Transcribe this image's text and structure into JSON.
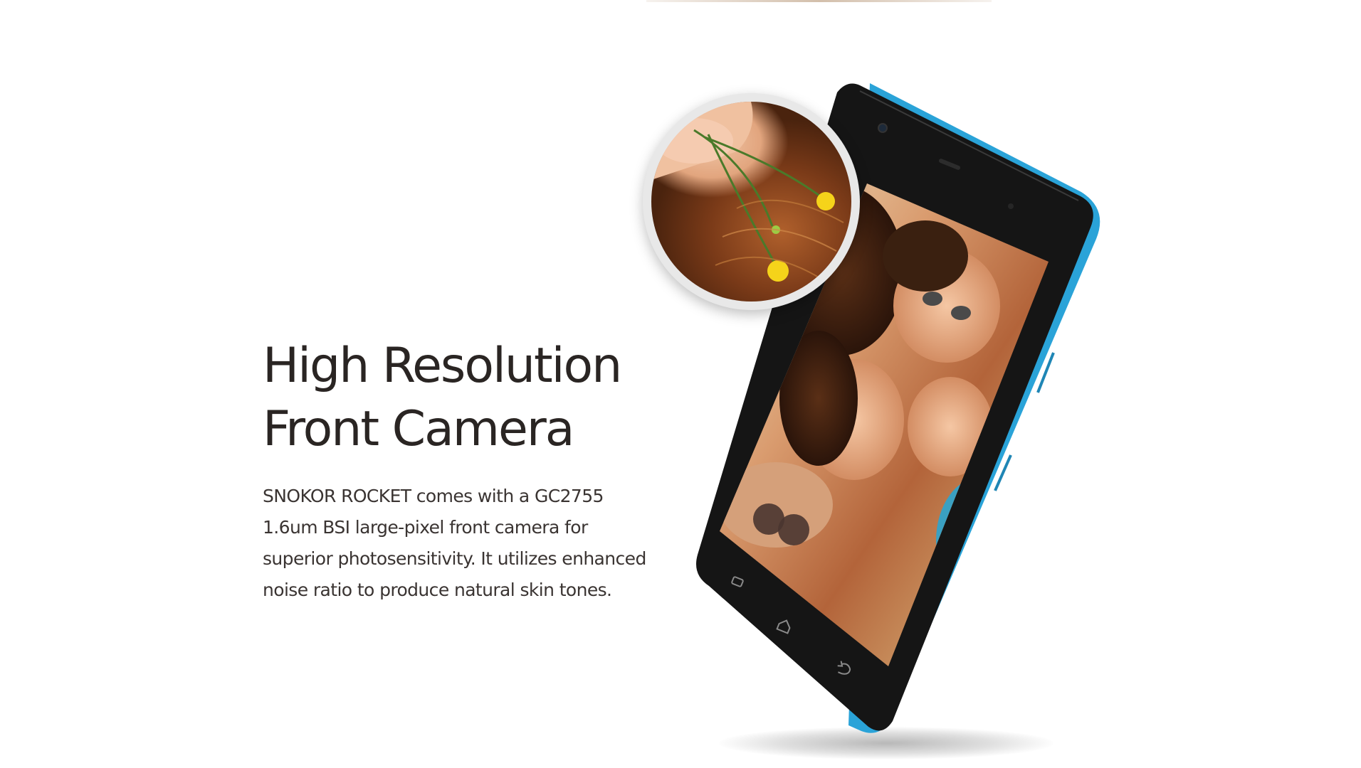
{
  "headline": {
    "line1": "High Resolution",
    "line2": "Front Camera"
  },
  "description": {
    "line1": "SNOKOR ROCKET comes with a GC2755",
    "line2": "1.6um BSI large-pixel front camera for",
    "line3": "superior photosensitivity. It utilizes enhanced",
    "line4": "noise ratio to produce natural skin tones."
  },
  "colors": {
    "text": "#2a2523",
    "phone_accent": "#2aa3d8",
    "phone_face": "#151515",
    "background": "#ffffff"
  },
  "icons": {
    "nav_recent": "recent-apps-icon",
    "nav_home": "home-icon",
    "nav_back": "back-icon",
    "front_camera": "front-camera-lens"
  }
}
